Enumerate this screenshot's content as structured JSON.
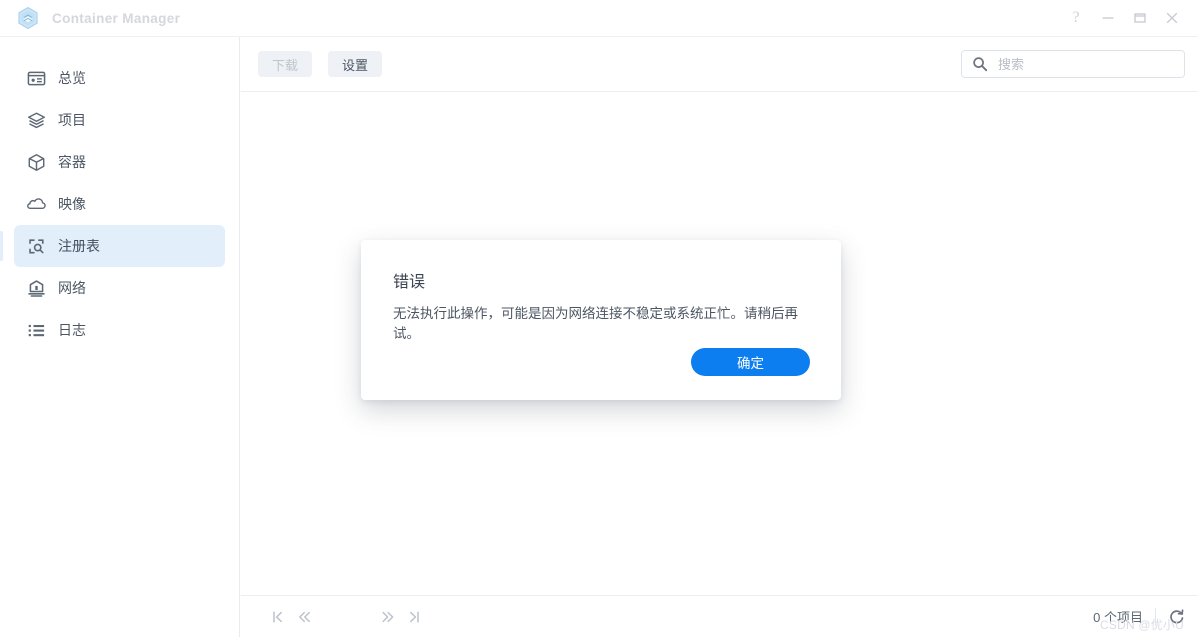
{
  "window": {
    "title": "Container Manager",
    "app_icon": "container-hexagon-icon",
    "controls": [
      {
        "name": "help-button",
        "glyph": "?"
      },
      {
        "name": "minimize-button",
        "glyph": "—"
      },
      {
        "name": "maximize-button",
        "glyph": "□"
      },
      {
        "name": "close-button",
        "glyph": "×"
      }
    ]
  },
  "sidebar": {
    "items": [
      {
        "label": "总览",
        "icon": "dashboard-card-icon",
        "selected": false
      },
      {
        "label": "项目",
        "icon": "layers-icon",
        "selected": false
      },
      {
        "label": "容器",
        "icon": "cube-icon",
        "selected": false
      },
      {
        "label": "映像",
        "icon": "cloud-icon",
        "selected": false
      },
      {
        "label": "注册表",
        "icon": "registry-search-icon",
        "selected": true
      },
      {
        "label": "网络",
        "icon": "router-icon",
        "selected": false
      },
      {
        "label": "日志",
        "icon": "list-icon",
        "selected": false
      }
    ]
  },
  "toolbar": {
    "download_label": "下载",
    "download_disabled": true,
    "settings_label": "设置",
    "settings_disabled": false
  },
  "search": {
    "icon": "search-icon",
    "placeholder": "搜索",
    "value": ""
  },
  "footer": {
    "pagination": [
      {
        "name": "first-page-button",
        "icon": "first-page-icon"
      },
      {
        "name": "prev-page-button",
        "icon": "chevron-double-left-icon"
      },
      {
        "name": "next-page-button",
        "icon": "chevron-double-right-icon"
      },
      {
        "name": "last-page-button",
        "icon": "last-page-icon"
      }
    ],
    "item_count": "0 个项目",
    "refresh_icon": "refresh-icon"
  },
  "dialog": {
    "title": "错误",
    "message": "无法执行此操作，可能是因为网络连接不稳定或系统正忙。请稍后再试。",
    "ok_label": "确定"
  },
  "watermark": {
    "text": "CSDN @优小U"
  },
  "colors": {
    "accent_blue": "#0d7ef0",
    "selected_nav_bg": "#e2effb",
    "toolbar_button_bg": "#eef1f6",
    "title_text": "#d4d7dd",
    "body_text": "#4c5663"
  }
}
